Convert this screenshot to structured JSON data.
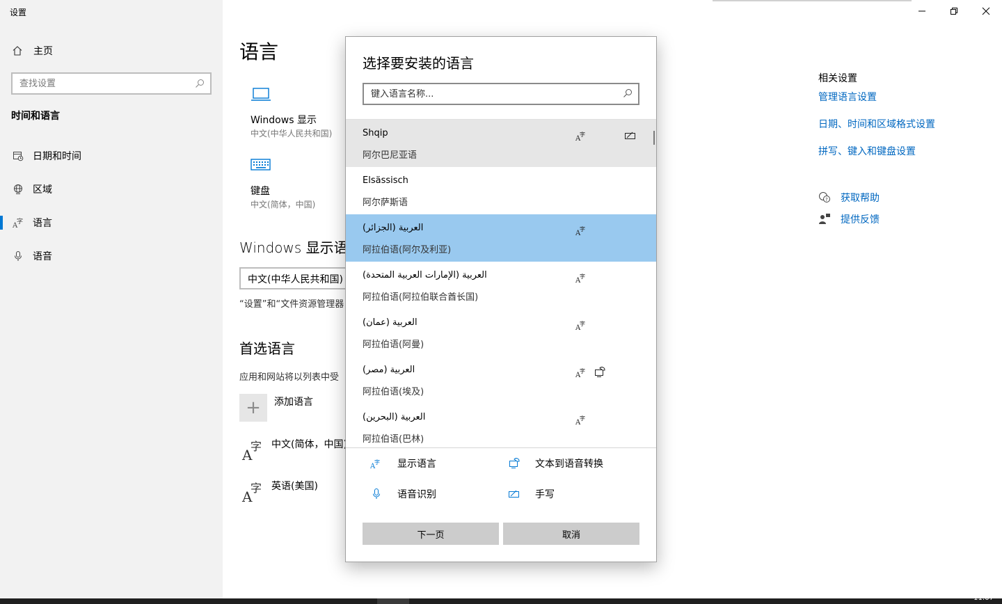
{
  "app": {
    "title": "设置"
  },
  "sidebar": {
    "home_label": "主页",
    "search_placeholder": "查找设置",
    "section_title": "时间和语言",
    "items": [
      {
        "label": "日期和时间",
        "icon": "calendar-clock-icon"
      },
      {
        "label": "区域",
        "icon": "globe-icon"
      },
      {
        "label": "语言",
        "icon": "language-icon",
        "selected": true
      },
      {
        "label": "语音",
        "icon": "microphone-icon"
      }
    ]
  },
  "main": {
    "heading": "语言",
    "tiles": [
      {
        "title": "Windows 显示",
        "subtitle": "中文(中华人民共和国)",
        "icon": "laptop-icon"
      },
      {
        "title": "键盘",
        "subtitle": "中文(简体，中国)",
        "icon": "keyboard-icon"
      }
    ],
    "display_lang_heading": "Windows 显示语言",
    "display_lang_value": "中文(中华人民共和国)",
    "display_lang_desc": "“设置”和“文件资源管理器",
    "preferred_heading": "首选语言",
    "preferred_desc": "应用和网站将以列表中受",
    "add_language_label": "添加语言",
    "preferred_languages": [
      {
        "label": "中文(简体，中国)"
      },
      {
        "label": "英语(美国)"
      }
    ]
  },
  "related": {
    "title": "相关设置",
    "links": [
      "管理语言设置",
      "日期、时间和区域格式设置",
      "拼写、键入和键盘设置"
    ],
    "help_label": "获取帮助",
    "feedback_label": "提供反馈"
  },
  "dialog": {
    "title": "选择要安装的语言",
    "search_placeholder": "键入语言名称...",
    "languages": [
      {
        "native": "Shqip",
        "chinese": "阿尔巴尼亚语",
        "state": "hover",
        "features": [
          "display",
          "",
          "handwriting"
        ]
      },
      {
        "native": "Elsässisch",
        "chinese": "阿尔萨斯语",
        "state": "",
        "features": []
      },
      {
        "native": "العربية (الجزائر)",
        "chinese": "阿拉伯语(阿尔及利亚)",
        "state": "selected",
        "features": [
          "display"
        ]
      },
      {
        "native": "العربية (الإمارات العربية المتحدة)",
        "chinese": "阿拉伯语(阿拉伯联合酋长国)",
        "state": "",
        "features": [
          "display"
        ]
      },
      {
        "native": "العربية (عمان)",
        "chinese": "阿拉伯语(阿曼)",
        "state": "",
        "features": [
          "display"
        ]
      },
      {
        "native": "العربية (مصر)",
        "chinese": "阿拉伯语(埃及)",
        "state": "",
        "features": [
          "display",
          "tts"
        ]
      },
      {
        "native": "العربية (البحرين)",
        "chinese": "阿拉伯语(巴林)",
        "state": "",
        "features": [
          "display"
        ]
      }
    ],
    "legend": {
      "display": "显示语言",
      "tts": "文本到语音转换",
      "speech": "语音识别",
      "handwriting": "手写"
    },
    "next_label": "下一页",
    "cancel_label": "取消"
  },
  "taskbar": {
    "clock": "11:07"
  },
  "colors": {
    "accent": "#0078d4",
    "link": "#0067c0",
    "selected_row": "#99c9ef",
    "hover_row": "#e6e6e6"
  }
}
